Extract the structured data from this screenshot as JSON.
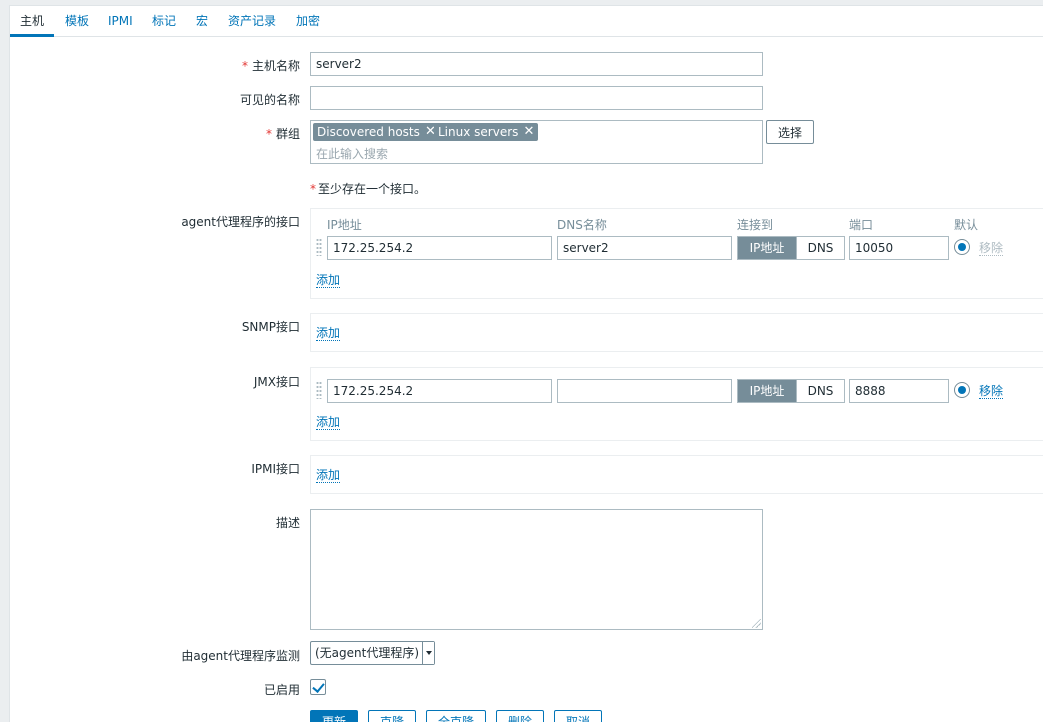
{
  "tabs": [
    "主机",
    "模板",
    "IPMI",
    "标记",
    "宏",
    "资产记录",
    "加密"
  ],
  "form": {
    "host_name_label": "主机名称",
    "host_name_value": "server2",
    "visible_name_label": "可见的名称",
    "visible_name_value": "",
    "groups_label": "群组",
    "groups": [
      "Discovered hosts",
      "Linux servers"
    ],
    "groups_placeholder": "在此输入搜索",
    "select_button": "选择",
    "interface_note": "至少存在一个接口。",
    "required_mark": "*",
    "remove_glyph": "✕"
  },
  "interfaces": {
    "headers": {
      "ip": "IP地址",
      "dns": "DNS名称",
      "connect": "连接到",
      "port": "端口",
      "default": "默认"
    },
    "agent_label": "agent代理程序的接口",
    "agent": {
      "ip": "172.25.254.2",
      "dns": "server2",
      "connect_ip": "IP地址",
      "connect_dns": "DNS",
      "port": "10050",
      "remove": "移除"
    },
    "snmp_label": "SNMP接口",
    "jmx_label": "JMX接口",
    "jmx": {
      "ip": "172.25.254.2",
      "dns": "",
      "connect_ip": "IP地址",
      "connect_dns": "DNS",
      "port": "8888",
      "remove": "移除"
    },
    "ipmi_label": "IPMI接口",
    "add": "添加"
  },
  "description_label": "描述",
  "description_value": "",
  "proxy_label": "由agent代理程序监测",
  "proxy_value": "(无agent代理程序)",
  "enabled_label": "已启用",
  "enabled": true,
  "buttons": {
    "update": "更新",
    "clone": "克隆",
    "full_clone": "全克隆",
    "delete": "删除",
    "cancel": "取消"
  },
  "colors": {
    "accent": "#0275b8",
    "required": "#e33734",
    "chip": "#768d99"
  }
}
